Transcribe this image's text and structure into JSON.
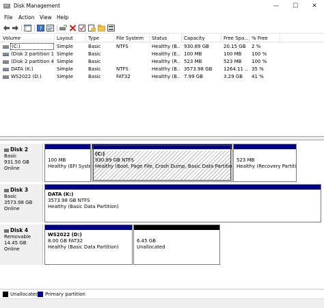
{
  "window": {
    "title": "Disk Management",
    "minimize": "—",
    "maximize": "☐",
    "close": "✕"
  },
  "menu": [
    "File",
    "Action",
    "View",
    "Help"
  ],
  "toolbar_icons": [
    "back-icon",
    "forward-icon",
    "show-hide-tree-icon",
    "help-icon",
    "properties-icon",
    "connect-drive-icon",
    "delete-icon",
    "check-icon",
    "new-folder-icon",
    "snapshot-icon"
  ],
  "columns": [
    "Volume",
    "Layout",
    "Type",
    "File System",
    "Status",
    "Capacity",
    "Free Spa...",
    "% Free"
  ],
  "volumes": [
    [
      "(C:)",
      "Simple",
      "Basic",
      "NTFS",
      "Healthy (B...",
      "930.89 GB",
      "20.15 GB",
      "2 %"
    ],
    [
      "(Disk 2 partition 1)",
      "Simple",
      "Basic",
      "",
      "Healthy (E...",
      "100 MB",
      "100 MB",
      "100 %"
    ],
    [
      "(Disk 2 partition 4)",
      "Simple",
      "Basic",
      "",
      "Healthy (R...",
      "523 MB",
      "523 MB",
      "100 %"
    ],
    [
      "DATA (K:)",
      "Simple",
      "Basic",
      "NTFS",
      "Healthy (B...",
      "3573.98 GB",
      "1264.11 ...",
      "35 %"
    ],
    [
      "WS2022 (D:)",
      "Simple",
      "Basic",
      "FAT32",
      "Healthy (B...",
      "7.99 GB",
      "3.29 GB",
      "41 %"
    ]
  ],
  "disks": [
    {
      "name": "Disk 2",
      "type": "Basic",
      "size": "931.50 GB",
      "status": "Online",
      "partitions": [
        {
          "name": "",
          "size": "100 MB",
          "status": "Healthy (EFI Syster"
        },
        {
          "name": "(C:)",
          "size": "930.89 GB NTFS",
          "status": "Healthy (Boot, Page File, Crash Dump, Basic Data Partition)"
        },
        {
          "name": "",
          "size": "523 MB",
          "status": "Healthy (Recovery Partitio"
        }
      ]
    },
    {
      "name": "Disk 3",
      "type": "Basic",
      "size": "3573.98 GB",
      "status": "Online",
      "partitions": [
        {
          "name": "DATA  (K:)",
          "size": "3573.98 GB NTFS",
          "status": "Healthy (Basic Data Partition)"
        }
      ]
    },
    {
      "name": "Disk 4",
      "type": "Removable",
      "size": "14.45 GB",
      "status": "Online",
      "partitions": [
        {
          "name": "WS2022  (D:)",
          "size": "8.00 GB FAT32",
          "status": "Healthy (Basic Data Partition)"
        },
        {
          "name": "",
          "size": "6.45 GB",
          "status": "Unallocated"
        }
      ]
    }
  ],
  "legend": [
    {
      "label": "Unallocated",
      "color": "#000000"
    },
    {
      "label": "Primary partition",
      "color": "#00008b"
    }
  ]
}
